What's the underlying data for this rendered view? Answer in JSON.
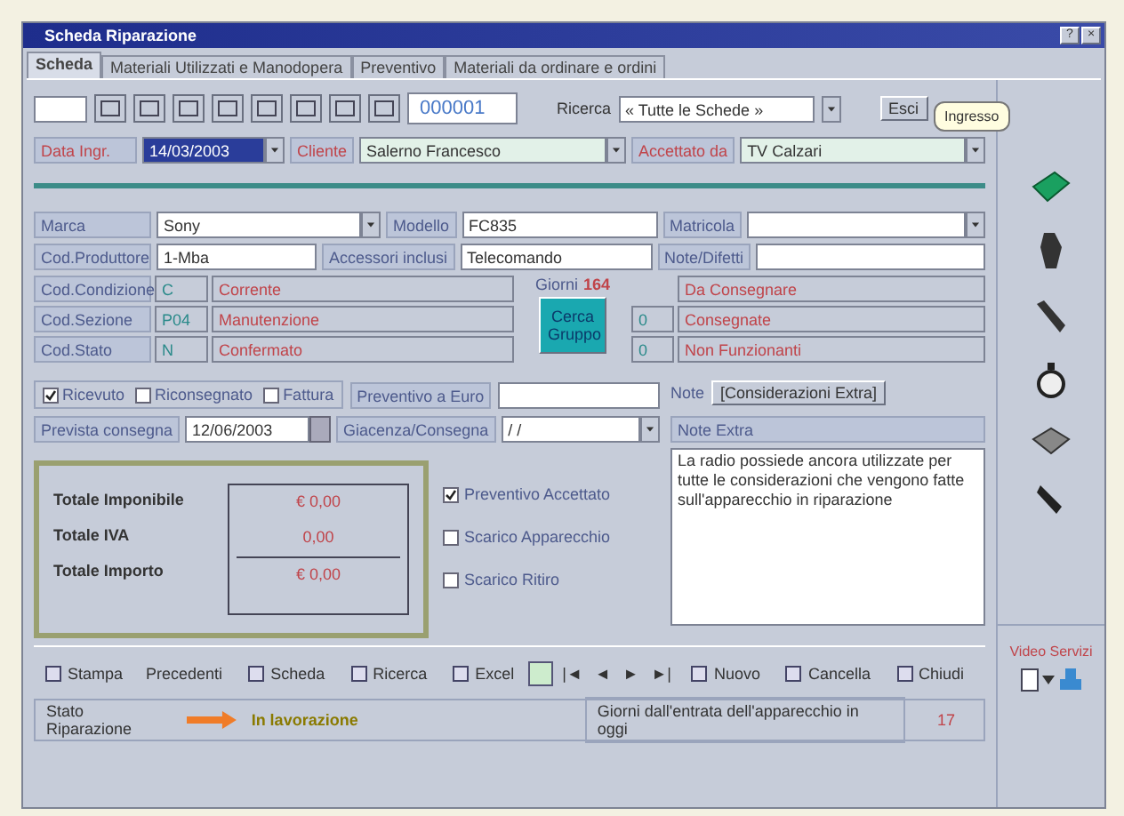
{
  "window": {
    "title": "Scheda Riparazione",
    "controls": [
      "?",
      "×"
    ]
  },
  "tabs": [
    {
      "label": "Scheda",
      "selected": true
    },
    {
      "label": "Materiali Utilizzati e Manodopera",
      "selected": false
    },
    {
      "label": "Preventivo",
      "selected": false
    },
    {
      "label": "Materiali da ordinare e ordini",
      "selected": false
    }
  ],
  "toolbar": {
    "record_number": "000001",
    "search_label": "Ricerca",
    "filter": "« Tutte le Schede »",
    "exit": "Esci"
  },
  "tooltip": "Ingresso",
  "header": [
    {
      "label": "Data Ingr.",
      "value": "14/03/2003",
      "selected": true
    },
    {
      "label": "Cliente",
      "value": "Salerno Francesco",
      "selected": false
    },
    {
      "label": "Accettato da",
      "value": "TV Calzari",
      "selected": false
    }
  ],
  "device": [
    {
      "label": "Marca",
      "value": "Sony",
      "kind": "dropdown"
    },
    {
      "label": "Modello",
      "value": "FC835",
      "kind": "text"
    },
    {
      "label": "Matricola",
      "kind": "dropdown"
    },
    {
      "label": "Cod.Produttore",
      "value": "1-Mba",
      "kind": "text"
    },
    {
      "label": "Accessori inclusi",
      "value": "Telecomando",
      "kind": "text"
    },
    {
      "label": "Note/Difetti",
      "kind": "text"
    }
  ],
  "codes": [
    {
      "label": "Cod.Condizione",
      "code": "C",
      "description": "Corrente"
    },
    {
      "label": "Cod.Sezione",
      "code": "P04",
      "description": "Manutenzione"
    },
    {
      "label": "Cod.Stato",
      "code": "N",
      "description": "Confermato"
    }
  ],
  "counter": {
    "label": "Giorni",
    "value": "164"
  },
  "group_button": "Cerca Gruppo",
  "delivery_counts": [
    {
      "label": "Da Consegnare"
    },
    {
      "count": "0",
      "label": "Consegnate"
    },
    {
      "count": "0",
      "label": "Non Funzionanti"
    }
  ],
  "state_options": [
    {
      "label": "Ricevuto",
      "checked": true
    },
    {
      "label": "Riconsegnato",
      "checked": false
    },
    {
      "label": "Fattura",
      "checked": false
    }
  ],
  "estimate_label": "Preventivo a Euro",
  "delivery": {
    "label": "Prevista consegna",
    "value": "12/06/2003"
  },
  "stock": {
    "label": "Giacenza/Consegna",
    "value": "/ /"
  },
  "notes": {
    "label": "Note",
    "button": "[Considerazioni Extra]",
    "extra_label": "Note Extra",
    "text": "La radio possiede ancora utilizzate per tutte le considerazioni che vengono fatte sull'apparecchio in riparazione"
  },
  "totals": [
    {
      "label": "Totale Imponibile",
      "value": "€ 0,00"
    },
    {
      "label": "Totale IVA",
      "value": "0,00"
    },
    {
      "label": "Totale Importo",
      "value": "€ 0,00"
    }
  ],
  "flags": [
    {
      "label": "Preventivo Accettato",
      "checked": true
    },
    {
      "label": "Scarico Apparecchio",
      "checked": false
    },
    {
      "label": "Scarico Ritiro",
      "checked": false
    }
  ],
  "bottom_toolbar": {
    "left": [
      "Stampa",
      "Precedenti",
      "Scheda",
      "Ricerca",
      "Excel"
    ],
    "nav": [
      "|◄",
      "◄",
      "►",
      "►|"
    ],
    "right": [
      "Nuovo",
      "Cancella",
      "Chiudi"
    ]
  },
  "status": {
    "label": "Stato Riparazione",
    "value": "In lavorazione",
    "days_label": "Giorni dall'entrata dell'apparecchio in oggi",
    "days": "17"
  },
  "side": {
    "caption": "Video Servizi"
  }
}
